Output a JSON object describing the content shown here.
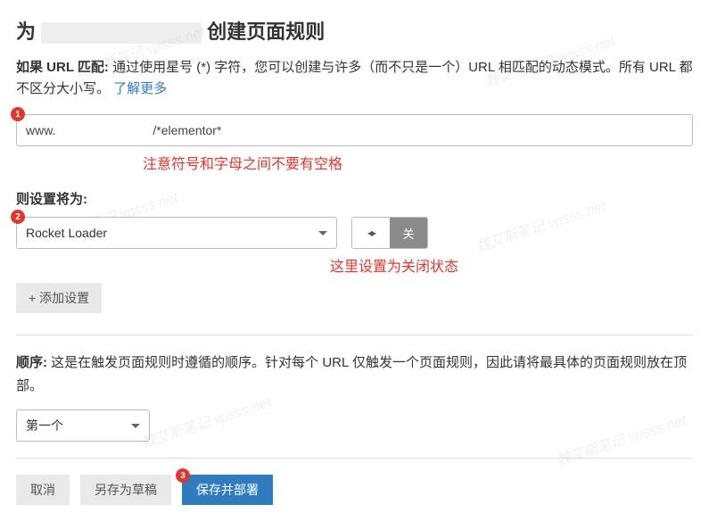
{
  "title": {
    "prefix": "为",
    "suffix": "创建页面规则"
  },
  "help": {
    "label": "如果 URL 匹配:",
    "text": "通过使用星号 (*) 字符，您可以创建与许多（而不只是一个）URL 相匹配的动态模式。所有 URL 都不区分大小写。",
    "link": "了解更多"
  },
  "badges": {
    "one": "1",
    "two": "2",
    "three": "3"
  },
  "url_input": {
    "value": "www.                            /*elementor*"
  },
  "annotations": {
    "no_space": "注意符号和字母之间不要有空格",
    "set_off": "这里设置为关闭状态"
  },
  "settings": {
    "label": "则设置将为:",
    "selected": "Rocket Loader",
    "toggle_off": "关",
    "add_setting": "+ 添加设置"
  },
  "order": {
    "label": "顺序:",
    "text": "这是在触发页面规则时遵循的顺序。针对每个 URL 仅触发一个页面规则，因此请将最具体的页面规则放在顶部。",
    "selected": "第一个"
  },
  "footer": {
    "cancel": "取消",
    "save_draft": "另存为草稿",
    "save_deploy": "保存并部署"
  },
  "watermark": "魏艾斯笔记 vpsss.net"
}
